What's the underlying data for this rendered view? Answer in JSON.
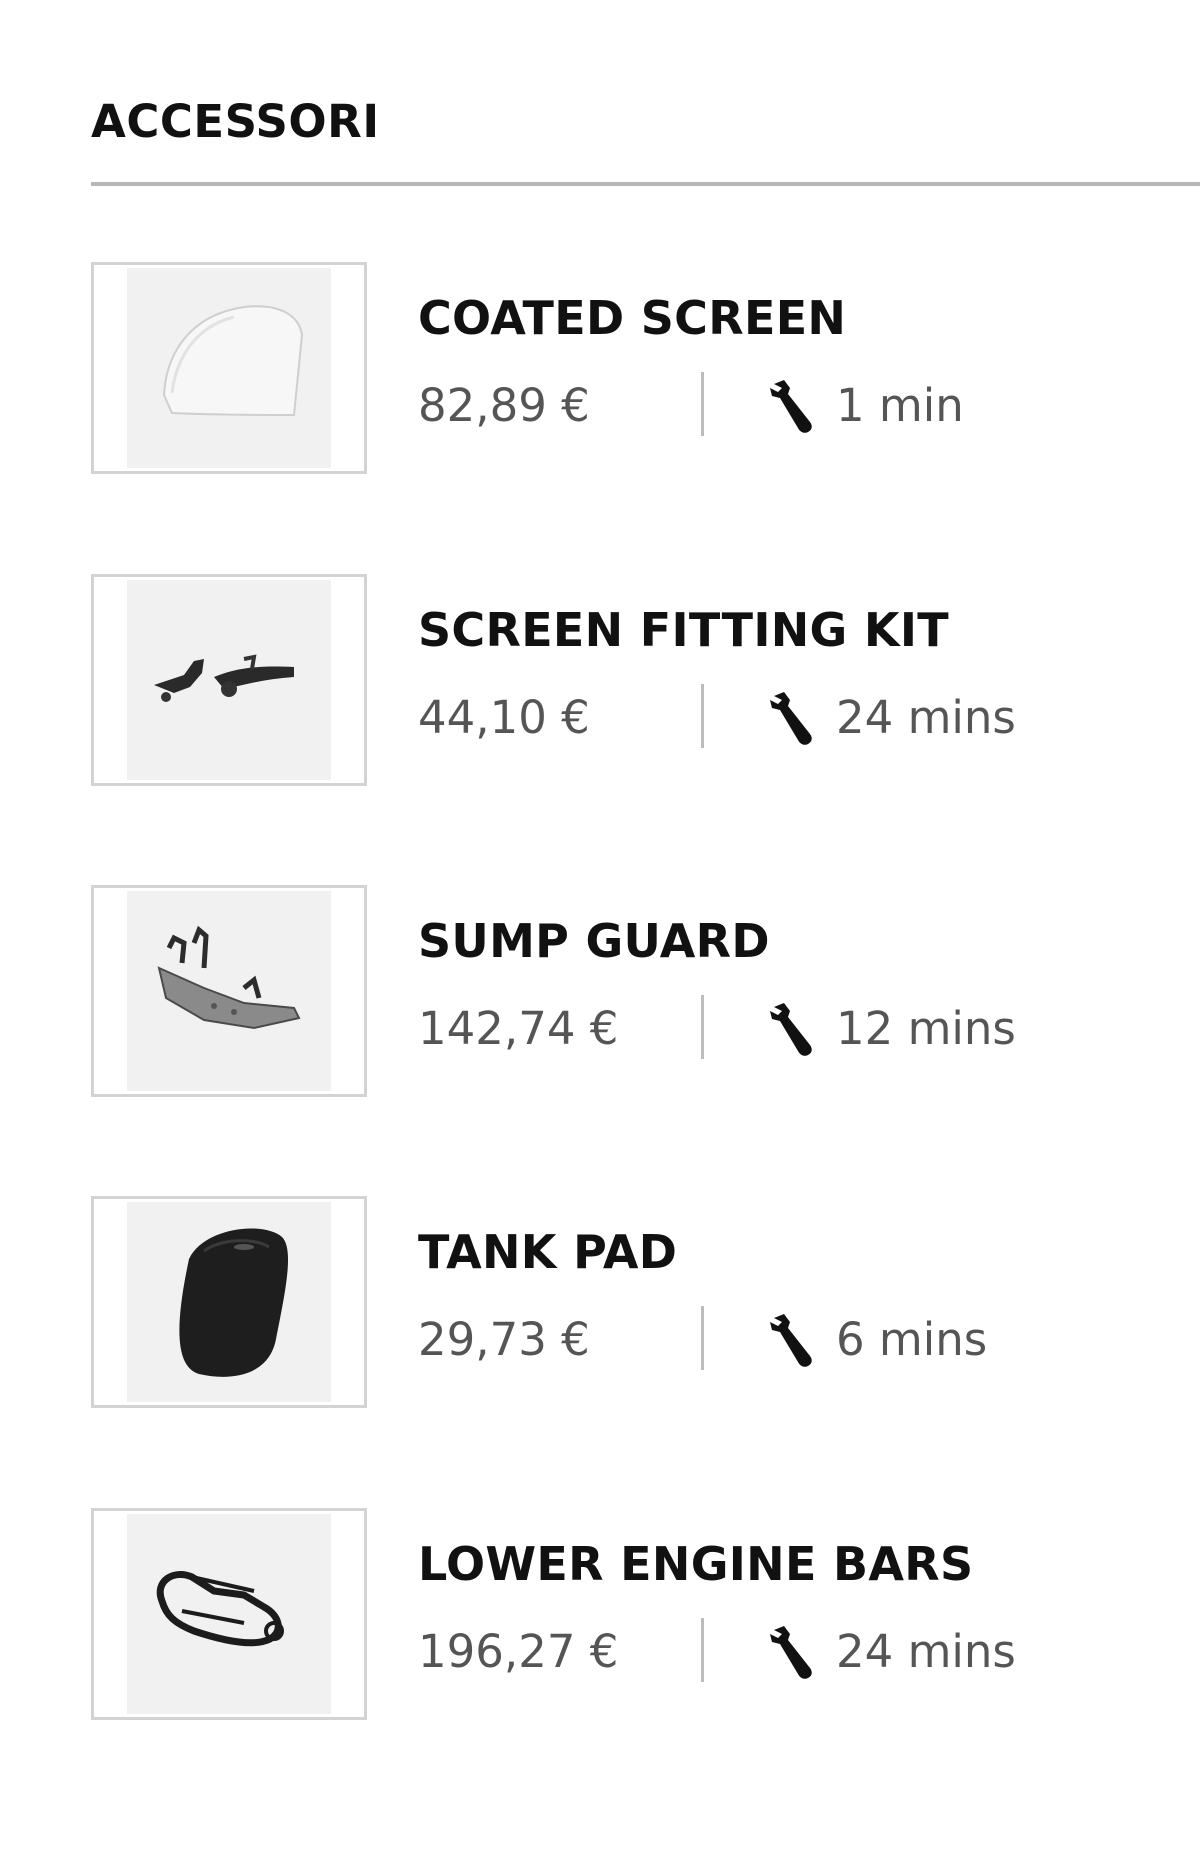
{
  "section": {
    "title": "ACCESSORI"
  },
  "items": [
    {
      "name": "COATED SCREEN",
      "price": "82,89 €",
      "duration": "1 min",
      "icon": "wrench-icon"
    },
    {
      "name": "SCREEN FITTING KIT",
      "price": "44,10 €",
      "duration": "24 mins",
      "icon": "wrench-icon"
    },
    {
      "name": "SUMP GUARD",
      "price": "142,74 €",
      "duration": "12 mins",
      "icon": "wrench-icon"
    },
    {
      "name": "TANK PAD",
      "price": "29,73 €",
      "duration": "6 mins",
      "icon": "wrench-icon"
    },
    {
      "name": "LOWER ENGINE BARS",
      "price": "196,27 €",
      "duration": "24 mins",
      "icon": "wrench-icon"
    }
  ],
  "colors": {
    "text": "#111111",
    "muted": "#555555",
    "divider": "#b7b7b7",
    "thumb_border": "#d3d3d3"
  }
}
